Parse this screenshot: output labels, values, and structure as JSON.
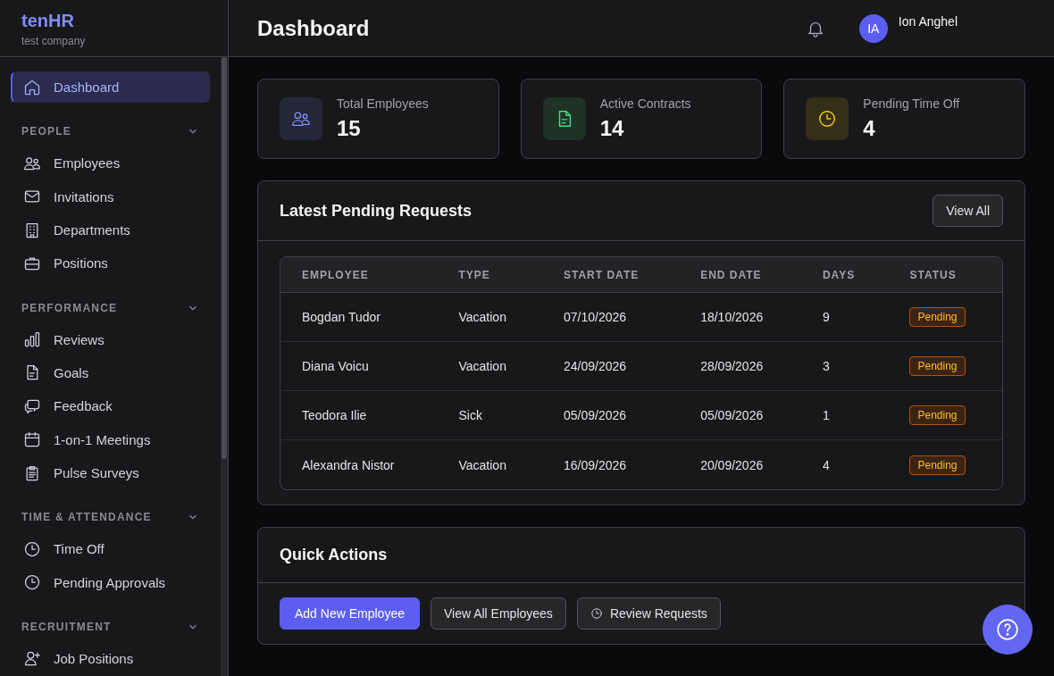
{
  "sidebar": {
    "brand": "tenHR",
    "company": "test company",
    "items": [
      {
        "label": "Dashboard",
        "selected": true
      }
    ],
    "sections": [
      {
        "title": "PEOPLE",
        "expanded": true,
        "items": [
          {
            "label": "Employees",
            "selected": false
          },
          {
            "label": "Invitations",
            "selected": false
          },
          {
            "label": "Departments",
            "selected": false
          },
          {
            "label": "Positions",
            "selected": false
          }
        ]
      },
      {
        "title": "PERFORMANCE",
        "expanded": true,
        "items": [
          {
            "label": "Reviews",
            "selected": false
          },
          {
            "label": "Goals",
            "selected": false
          },
          {
            "label": "Feedback",
            "selected": false
          },
          {
            "label": "1-on-1 Meetings",
            "selected": false
          },
          {
            "label": "Pulse Surveys",
            "selected": false
          }
        ]
      },
      {
        "title": "TIME & ATTENDANCE",
        "expanded": true,
        "items": [
          {
            "label": "Time Off",
            "selected": false
          },
          {
            "label": "Pending Approvals",
            "selected": false
          }
        ]
      },
      {
        "title": "RECRUITMENT",
        "expanded": true,
        "items": [
          {
            "label": "Job Positions",
            "selected": false
          }
        ]
      }
    ]
  },
  "header": {
    "title": "Dashboard",
    "user": {
      "initials": "IA",
      "name": "Ion Anghel"
    }
  },
  "stats": [
    {
      "label": "Total Employees",
      "value": "15",
      "color": "#818cf8"
    },
    {
      "label": "Active Contracts",
      "value": "14",
      "color": "#4ade80"
    },
    {
      "label": "Pending Time Off",
      "value": "4",
      "color": "#facc15"
    }
  ],
  "requests": {
    "title": "Latest Pending Requests",
    "button": "View All",
    "table": {
      "columns": [
        "EMPLOYEE",
        "TYPE",
        "START DATE",
        "END DATE",
        "DAYS",
        "STATUS"
      ],
      "rows": [
        {
          "cells": [
            "Bogdan Tudor",
            "Vacation",
            "07/10/2026",
            "18/10/2026",
            "9"
          ],
          "status": "Pending"
        },
        {
          "cells": [
            "Diana Voicu",
            "Vacation",
            "24/09/2026",
            "28/09/2026",
            "3"
          ],
          "status": "Pending"
        },
        {
          "cells": [
            "Teodora Ilie",
            "Sick",
            "05/09/2026",
            "05/09/2026",
            "1"
          ],
          "status": "Pending"
        },
        {
          "cells": [
            "Alexandra Nistor",
            "Vacation",
            "16/09/2026",
            "20/09/2026",
            "4"
          ],
          "status": "Pending"
        }
      ]
    }
  },
  "quick_actions": {
    "title": "Quick Actions",
    "buttons": [
      {
        "label": "Add New Employee",
        "kind": "primary"
      },
      {
        "label": "View All Employees",
        "kind": "outline"
      },
      {
        "label": "Review Requests",
        "kind": "outline-icon"
      }
    ]
  }
}
